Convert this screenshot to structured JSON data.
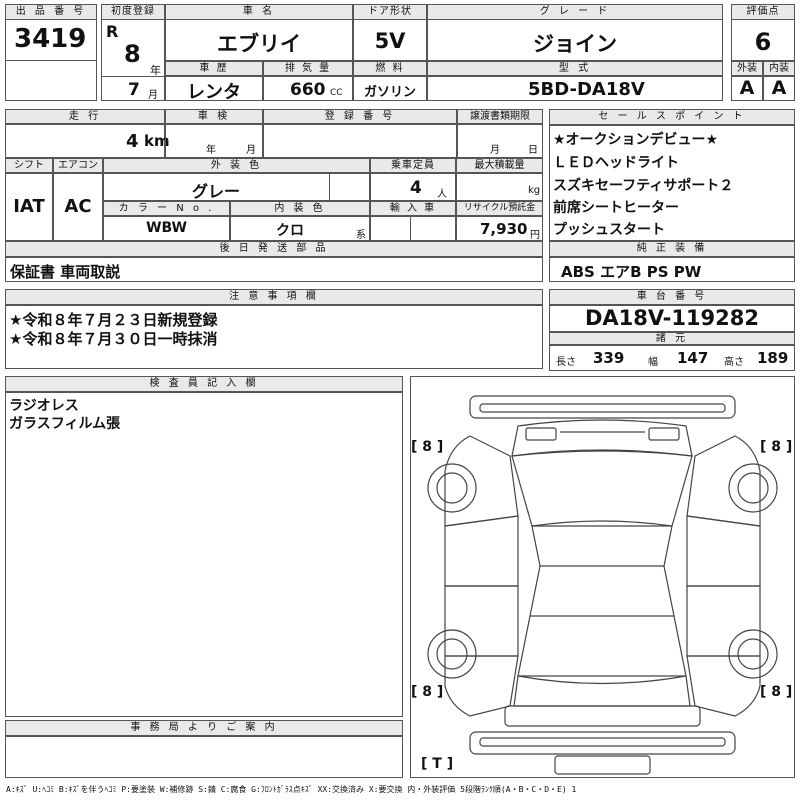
{
  "header": {
    "lot_no_label": "出 品 番 号",
    "lot_no": "3419",
    "first_reg_label": "初度登録",
    "era": "R",
    "reg_year": "8",
    "year_unit": "年",
    "reg_month": "7",
    "month_unit": "月",
    "car_name_label": "車 名",
    "car_name": "エブリイ",
    "door_label": "ドア形状",
    "door": "5V",
    "grade_label": "グ レ ー ド",
    "grade": "ジョイン",
    "score_label": "評価点",
    "score": "6",
    "history_label": "車 歴",
    "history": "レンタ",
    "displacement_label": "排 気 量",
    "displacement": "660",
    "cc": "CC",
    "fuel_label": "燃 料",
    "fuel": "ガソリン",
    "model_label": "型 式",
    "model": "5BD-DA18V",
    "exterior_label": "外装",
    "exterior": "A",
    "interior_label": "内装",
    "interior": "A"
  },
  "row2": {
    "mileage_label": "走 行",
    "mileage": "4",
    "km": "km",
    "inspection_label": "車 検",
    "insp_year": "年",
    "insp_month": "月",
    "regno_label": "登 録 番 号",
    "transfer_label": "譲渡書類期限",
    "tr_month": "月",
    "tr_day": "日",
    "shift_label": "シフト",
    "shift": "IAT",
    "ac_label": "エアコン",
    "ac": "AC",
    "color_label": "外 装 色",
    "color": "グレー",
    "seats_label": "乗車定員",
    "seats": "4",
    "seats_unit": "人",
    "load_label": "最大積載量",
    "load_unit": "kg",
    "color_no_label": "カ ラ ー N o .",
    "color_no": "WBW",
    "int_color_label": "内 装 色",
    "int_color": "クロ",
    "int_color_unit": "系",
    "import_label": "輸 入 車",
    "recycle_label": "リサイクル預託金",
    "recycle": "7,930",
    "recycle_unit": "円",
    "later_label": "後 日 発 送 部 品",
    "later": "保証書 車両取説"
  },
  "sales": {
    "label": "セ ー ル ス ポ イ ン ト",
    "items": [
      "★オークションデビュー★",
      "ＬＥＤヘッドライト",
      "スズキセーフティサポート２",
      "前席シートヒーター",
      "プッシュスタート"
    ],
    "equipment_label": "純 正 装 備",
    "equipment": "ABS エアB PS PW"
  },
  "notes": {
    "label": "注 意 事 項 欄",
    "lines": [
      "★令和８年７月２３日新規登録",
      "★令和８年７月３０日一時抹消"
    ]
  },
  "chassis": {
    "label": "車 台 番 号",
    "number": "DA18V-119282",
    "spec_label": "諸 元",
    "length_label": "長さ",
    "length": "339",
    "width_label": "幅",
    "width": "147",
    "height_label": "高さ",
    "height": "189"
  },
  "inspector": {
    "label": "検 査 員 記 入 欄",
    "lines": [
      "ラジオレス",
      "ガラスフィルム張"
    ]
  },
  "diagram": {
    "tire_fl": "[ 8 ]",
    "tire_fr": "[ 8 ]",
    "tire_rl": "[ 8 ]",
    "tire_rr": "[ 8 ]",
    "spare": "[ T ]"
  },
  "office": {
    "label": "事 務 局 よ り ご 案 内"
  },
  "legend": "A:ｷｽﾞ U:ﾍｺﾐ B:ｷｽﾞを伴うﾍｺﾐ P:要塗装 W:補修跡 S:錆 C:腐食 G:ﾌﾛﾝﾄｶﾞﾗｽ点ｷｽﾞ XX:交換済み X:要交換 内・外装評価 5段階ﾗﾝｸ順(A・B・C・D・E) 1"
}
